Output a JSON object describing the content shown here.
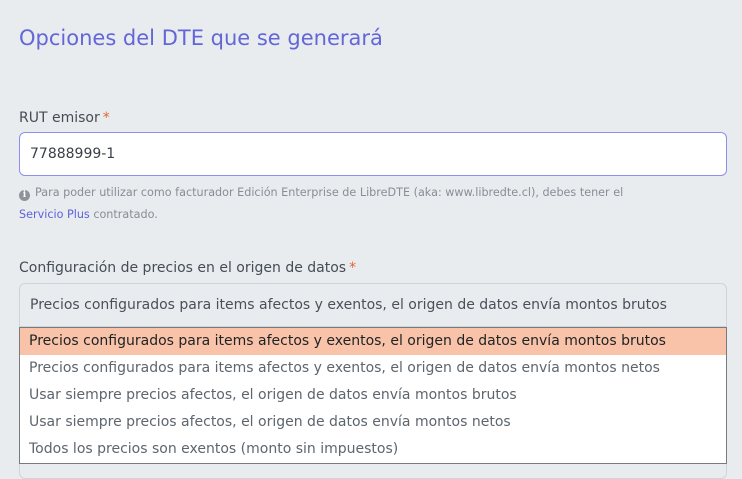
{
  "section": {
    "title": "Opciones del DTE que se generará"
  },
  "rut": {
    "label": "RUT emisor",
    "required_mark": "*",
    "value": "77888999-1"
  },
  "help": {
    "icon": "info-icon",
    "text": "Para poder utilizar como facturador Edición Enterprise de LibreDTE (aka: www.libredte.cl), debes tener el",
    "link_text": "Servicio Plus",
    "text_after": "contratado."
  },
  "precios": {
    "label": "Configuración de precios en el origen de datos",
    "required_mark": "*",
    "selected": "Precios configurados para items afectos y exentos, el origen de datos envía montos brutos",
    "options": [
      "Precios configurados para items afectos y exentos, el origen de datos envía montos brutos",
      "Precios configurados para items afectos y exentos, el origen de datos envía montos netos",
      "Usar siempre precios afectos, el origen de datos envía montos brutos",
      "Usar siempre precios afectos, el origen de datos envía montos netos",
      "Todos los precios son exentos (monto sin impuestos)"
    ],
    "highlighted_index": 0
  },
  "colors": {
    "accent": "#6366d6",
    "required": "#e0652e",
    "highlight": "#f8c3a8",
    "background": "#e9ecef"
  }
}
